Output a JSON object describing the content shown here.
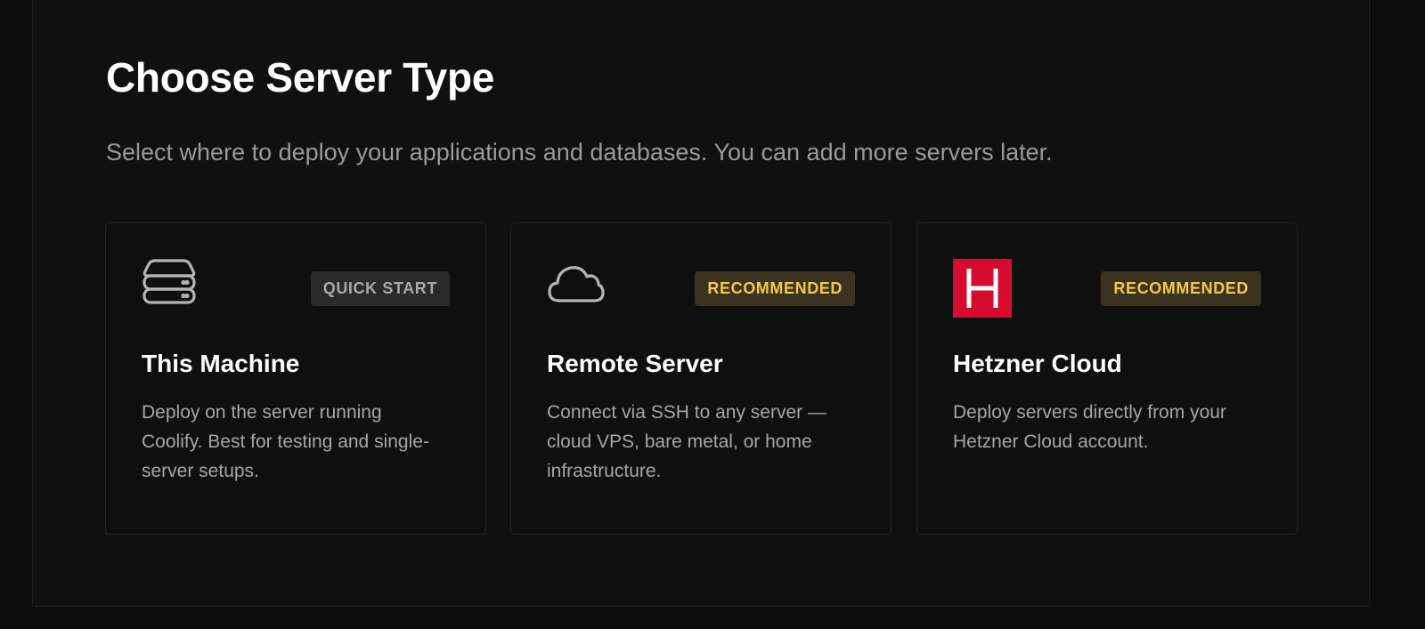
{
  "page": {
    "title": "Choose Server Type",
    "subtitle": "Select where to deploy your applications and databases. You can add more servers later."
  },
  "cards": [
    {
      "icon": "server-stack-icon",
      "badge": "QUICK START",
      "title": "This Machine",
      "description": "Deploy on the server running Coolify. Best for testing and single-server setups."
    },
    {
      "icon": "cloud-icon",
      "badge": "RECOMMENDED",
      "title": "Remote Server",
      "description": "Connect via SSH to any server —cloud VPS, bare metal, or home infrastructure."
    },
    {
      "icon": "hetzner-logo",
      "badge": "RECOMMENDED",
      "title": "Hetzner Cloud",
      "description": "Deploy servers directly from your Hetzner Cloud account."
    }
  ],
  "colors": {
    "background": "#101010",
    "badge_recommended_bg": "#3b3320",
    "badge_recommended_text": "#f2c94c",
    "badge_neutral_bg": "#2a2a2a",
    "badge_neutral_text": "#a8a8a8",
    "hetzner_red": "#d50c2d"
  }
}
